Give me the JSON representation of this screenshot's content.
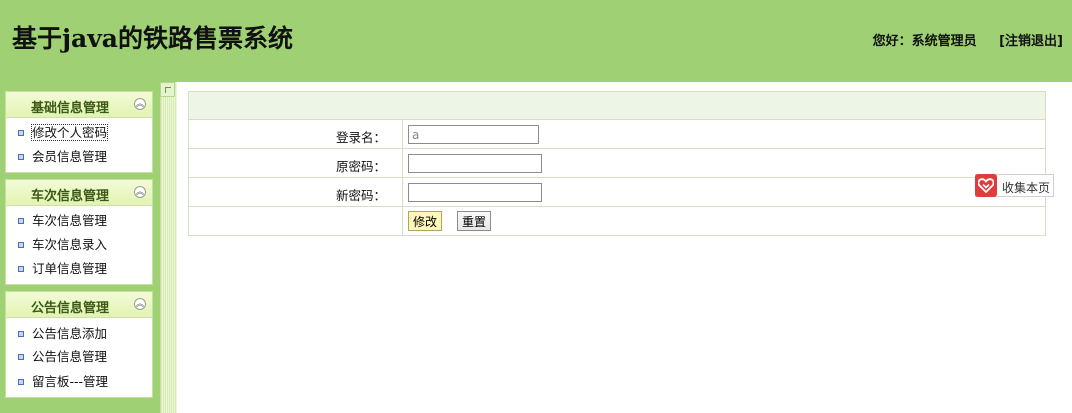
{
  "header": {
    "title": "基于java的铁路售票系统",
    "greeting": "您好：系统管理员",
    "logout_label": "[注销退出]"
  },
  "sidebar": {
    "groups": [
      {
        "title": "基础信息管理",
        "items": [
          "修改个人密码",
          "会员信息管理"
        ]
      },
      {
        "title": "车次信息管理",
        "items": [
          "车次信息管理",
          "车次信息录入",
          "订单信息管理"
        ]
      },
      {
        "title": "公告信息管理",
        "items": [
          "公告信息添加",
          "公告信息管理",
          "留言板---管理"
        ]
      }
    ]
  },
  "form": {
    "username_label": "登录名：",
    "username_value": "a",
    "old_password_label": "原密码：",
    "old_password_value": "",
    "new_password_label": "新密码：",
    "new_password_value": "",
    "submit_label": "修改",
    "reset_label": "重置"
  },
  "favorite": {
    "label": "收集本页"
  },
  "icons": {
    "collapse": "double-chevron-up-icon",
    "bullet": "square-bullet-icon",
    "favorite": "heart-icon"
  },
  "colors": {
    "header_bg": "#9fd174",
    "form_header_bg": "#edf5e6",
    "favorite_accent": "#e23b3b"
  }
}
